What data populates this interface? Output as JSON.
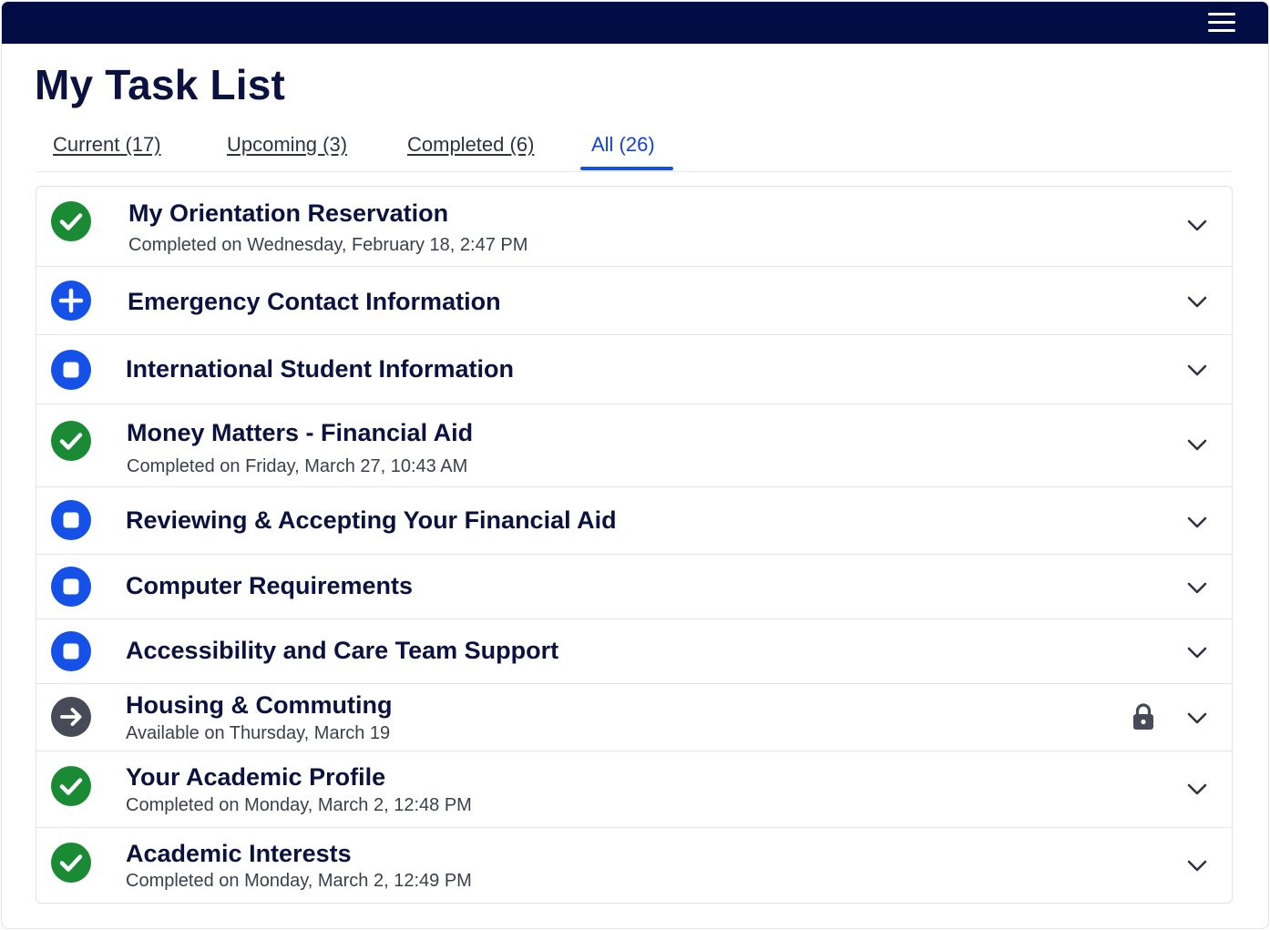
{
  "header": {
    "menu_icon": "hamburger-menu-icon",
    "background": "#020c45"
  },
  "page": {
    "title": "My Task List"
  },
  "tabs": [
    {
      "label": "Current (17)",
      "active": false
    },
    {
      "label": "Upcoming (3)",
      "active": false
    },
    {
      "label": "Completed (6)",
      "active": false
    },
    {
      "label": "All (26)",
      "active": true
    }
  ],
  "colors": {
    "complete": "#1a8a35",
    "todo": "#1551e6",
    "locked": "#474b57",
    "accent": "#1342d8"
  },
  "tasks": [
    {
      "title": "My Orientation Reservation",
      "subtitle": "Completed on Wednesday, February 18, 2:47 PM",
      "status": "completed",
      "icon": "check-circle-icon"
    },
    {
      "title": "Emergency Contact Information",
      "subtitle": "",
      "status": "in-progress",
      "icon": "plus-circle-icon"
    },
    {
      "title": "International Student Information",
      "subtitle": "",
      "status": "not-started",
      "icon": "square-circle-icon"
    },
    {
      "title": "Money Matters - Financial Aid",
      "subtitle": "Completed on Friday, March 27, 10:43 AM",
      "status": "completed",
      "icon": "check-circle-icon"
    },
    {
      "title": "Reviewing & Accepting Your Financial Aid",
      "subtitle": "",
      "status": "not-started",
      "icon": "square-circle-icon"
    },
    {
      "title": "Computer Requirements",
      "subtitle": "",
      "status": "not-started",
      "icon": "square-circle-icon"
    },
    {
      "title": "Accessibility and Care Team Support",
      "subtitle": "",
      "status": "not-started",
      "icon": "square-circle-icon"
    },
    {
      "title": "Housing & Commuting",
      "subtitle": "Available on Thursday, March 19",
      "status": "locked",
      "icon": "arrow-right-circle-icon",
      "locked_icon": "lock-icon"
    },
    {
      "title": "Your Academic Profile",
      "subtitle": "Completed on Monday, March 2, 12:48 PM",
      "status": "completed",
      "icon": "check-circle-icon"
    },
    {
      "title": "Academic Interests",
      "subtitle": "Completed on Monday, March 2, 12:49 PM",
      "status": "completed",
      "icon": "check-circle-icon"
    }
  ]
}
